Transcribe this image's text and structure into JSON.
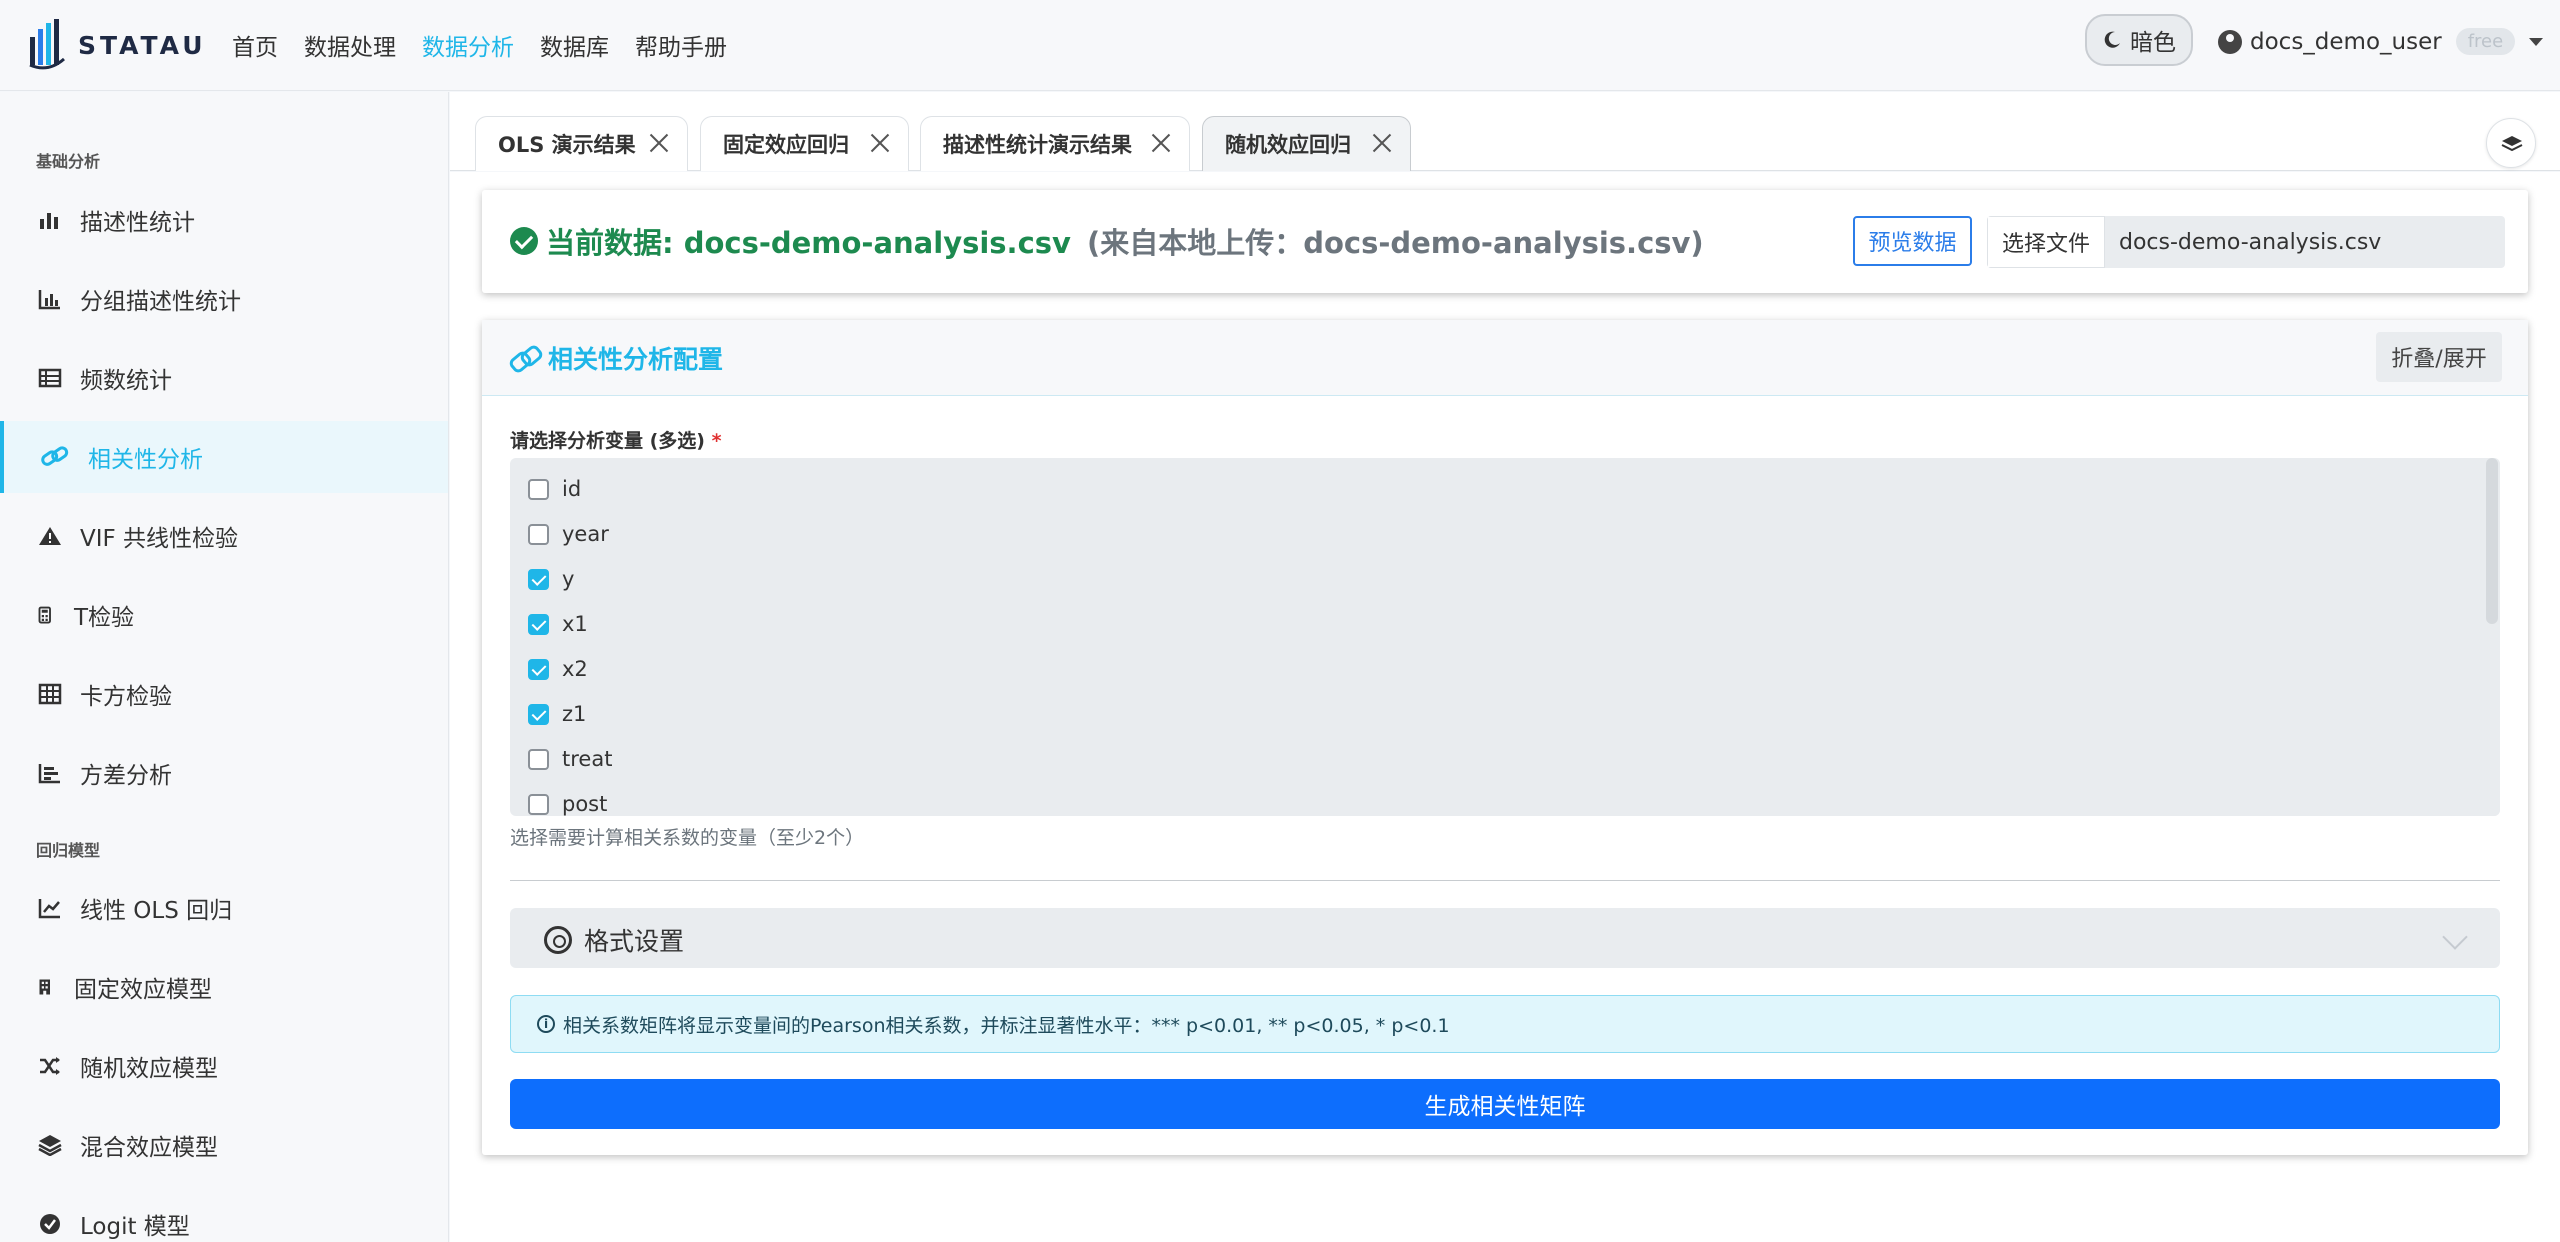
{
  "brand": {
    "name": "STATAU"
  },
  "nav": [
    {
      "label": "首页",
      "active": false
    },
    {
      "label": "数据处理",
      "active": false
    },
    {
      "label": "数据分析",
      "active": true
    },
    {
      "label": "数据库",
      "active": false
    },
    {
      "label": "帮助手册",
      "active": false
    }
  ],
  "theme_toggle": {
    "label": "暗色",
    "icon": "moon-icon"
  },
  "user": {
    "name": "docs_demo_user",
    "plan": "free"
  },
  "sidebar": {
    "section_basic": "基础分析",
    "section_regression": "回归模型",
    "items": [
      {
        "label": "描述性统计",
        "icon": "bar-chart-icon"
      },
      {
        "label": "分组描述性统计",
        "icon": "grouped-chart-icon"
      },
      {
        "label": "频数统计",
        "icon": "table-list-icon"
      },
      {
        "label": "相关性分析",
        "icon": "link-icon",
        "active": true
      },
      {
        "label": "VIF 共线性检验",
        "icon": "warning-icon"
      },
      {
        "label": "T检验",
        "icon": "calculator-icon"
      },
      {
        "label": "卡方检验",
        "icon": "grid-icon"
      },
      {
        "label": "方差分析",
        "icon": "bar-sorted-icon"
      },
      {
        "label": "线性 OLS 回归",
        "icon": "line-chart-icon"
      },
      {
        "label": "固定效应模型",
        "icon": "building-icon"
      },
      {
        "label": "随机效应模型",
        "icon": "shuffle-icon"
      },
      {
        "label": "混合效应模型",
        "icon": "layers-icon"
      },
      {
        "label": "Logit 模型",
        "icon": "check-circle-icon"
      }
    ]
  },
  "tabs": [
    {
      "label": "OLS 演示结果",
      "active": false
    },
    {
      "label": "固定效应回归",
      "active": false
    },
    {
      "label": "描述性统计演示结果",
      "active": false
    },
    {
      "label": "随机效应回归",
      "active": true
    }
  ],
  "data_card": {
    "title": "当前数据: docs-demo-analysis.csv",
    "source": "(来自本地上传：docs-demo-analysis.csv)",
    "preview_label": "预览数据",
    "choose_file_label": "选择文件",
    "file_name": "docs-demo-analysis.csv"
  },
  "config": {
    "title": "相关性分析配置",
    "collapse_label": "折叠/展开",
    "var_label": "请选择分析变量 (多选)",
    "required_mark": "*",
    "variables": [
      {
        "name": "id",
        "checked": false
      },
      {
        "name": "year",
        "checked": false
      },
      {
        "name": "y",
        "checked": true
      },
      {
        "name": "x1",
        "checked": true
      },
      {
        "name": "x2",
        "checked": true
      },
      {
        "name": "z1",
        "checked": true
      },
      {
        "name": "treat",
        "checked": false
      },
      {
        "name": "post",
        "checked": false
      }
    ],
    "var_help": "选择需要计算相关系数的变量（至少2个）",
    "format_label": "格式设置",
    "info_text": "相关系数矩阵将显示变量间的Pearson相关系数，并标注显著性水平：*** p<0.01, ** p<0.05, * p<0.1",
    "generate_label": "生成相关性矩阵"
  },
  "colors": {
    "accent": "#1fb6e8",
    "success": "#1d8a4f",
    "primary_button": "#0d6efd"
  }
}
